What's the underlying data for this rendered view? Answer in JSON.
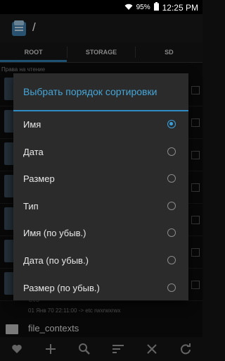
{
  "status_bar": {
    "battery_percent": "95%",
    "time": "12:25 PM"
  },
  "action_bar": {
    "path": "/"
  },
  "tabs": [
    {
      "label": "ROOT",
      "active": true
    },
    {
      "label": "STORAGE",
      "active": false
    },
    {
      "label": "SD",
      "active": false
    }
  ],
  "background_list": {
    "permission_label": "Права на чтение",
    "etc_name": "etc",
    "etc_meta": "01 Янв 70 22:11:00  -> etc  rwxrwxrwx",
    "file_name": "file_contexts"
  },
  "dialog": {
    "title": "Выбрать порядок сортировки",
    "options": [
      {
        "label": "Имя",
        "checked": true
      },
      {
        "label": "Дата",
        "checked": false
      },
      {
        "label": "Размер",
        "checked": false
      },
      {
        "label": "Тип",
        "checked": false
      },
      {
        "label": "Имя (по убыв.)",
        "checked": false
      },
      {
        "label": "Дата (по убыв.)",
        "checked": false
      },
      {
        "label": "Размер (по убыв.)",
        "checked": false
      }
    ]
  },
  "bottom_bar": {
    "icons": [
      "heart-icon",
      "plus-icon",
      "search-icon",
      "sort-icon",
      "close-icon",
      "refresh-icon"
    ]
  },
  "colors": {
    "accent": "#2e8bc4",
    "dialog_title": "#45a6d8",
    "dialog_bg": "#2b2b2b"
  }
}
